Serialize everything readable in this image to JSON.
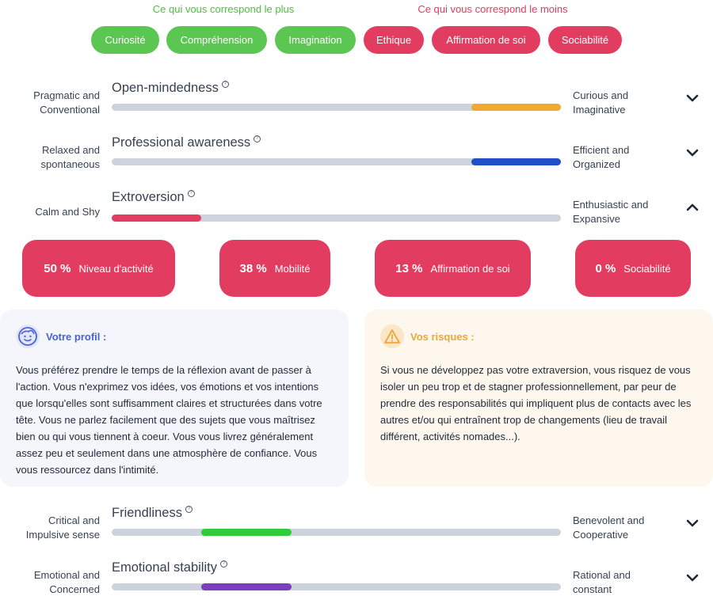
{
  "header": {
    "plus_label": "Ce qui vous correspond le plus",
    "moins_label": "Ce qui vous correspond le moins"
  },
  "pills": {
    "plus": [
      "Curiosité",
      "Compréhension",
      "Imagination"
    ],
    "moins": [
      "Ethique",
      "Affirmation de soi",
      "Sociabilité"
    ]
  },
  "traits_top": [
    {
      "left": "Pragmatic and Conventional",
      "title": "Open-mindedness",
      "right": "Curious and Imaginative",
      "range": [
        0.8,
        1.0
      ],
      "color": "#f3a92f",
      "expanded": false
    },
    {
      "left": "Relaxed and spontaneous",
      "title": "Professional awareness",
      "right": "Efficient and Organized",
      "range": [
        0.8,
        1.0
      ],
      "color": "#1f4fc5",
      "expanded": false
    },
    {
      "left": "Calm and Shy",
      "title": "Extroversion",
      "right": "Enthusiastic and Expansive",
      "range": [
        0.0,
        0.2
      ],
      "color": "#e23d61",
      "expanded": true
    }
  ],
  "stats": [
    {
      "pct": "50 %",
      "label": "Niveau d'activité"
    },
    {
      "pct": "38 %",
      "label": "Mobilité"
    },
    {
      "pct": "13 %",
      "label": "Affirmation de soi"
    },
    {
      "pct": "0 %",
      "label": "Sociabilité"
    }
  ],
  "profile": {
    "title": "Votre profil :",
    "icon": "face-icon",
    "body": "Vous préférez prendre le temps de la réflexion avant de passer à l'action. Vous n'exprimez vos idées, vos émotions et vos intentions que lorsqu'elles sont suffisamment claires et structurées dans votre tête. Vous ne parlez facilement que des sujets que vous maîtrisez bien ou qui vous tiennent à coeur. Vous vous livrez généralement assez peu et seulement dans une atmosphère de confiance. Vous vous ressourcez dans l'intimité."
  },
  "risks": {
    "title": "Vos risques :",
    "icon": "warning-icon",
    "body": "Si vous ne développez pas votre extraversion, vous risquez de vous isoler un peu trop et de stagner professionnellement, par peur de prendre des responsabilités qui impliquent plus de contacts avec les autres et/ou qui entraînent trop de changements (lieu de travail différent, activités nomades...)."
  },
  "traits_bottom": [
    {
      "left": "Critical and Impulsive sense",
      "title": "Friendliness",
      "right": "Benevolent and Cooperative",
      "range": [
        0.2,
        0.4
      ],
      "color": "#2ecc3a",
      "expanded": false
    },
    {
      "left": "Emotional and Concerned",
      "title": "Emotional stability",
      "right": "Rational and constant",
      "range": [
        0.2,
        0.4
      ],
      "color": "#7a3fbb",
      "expanded": false
    }
  ]
}
